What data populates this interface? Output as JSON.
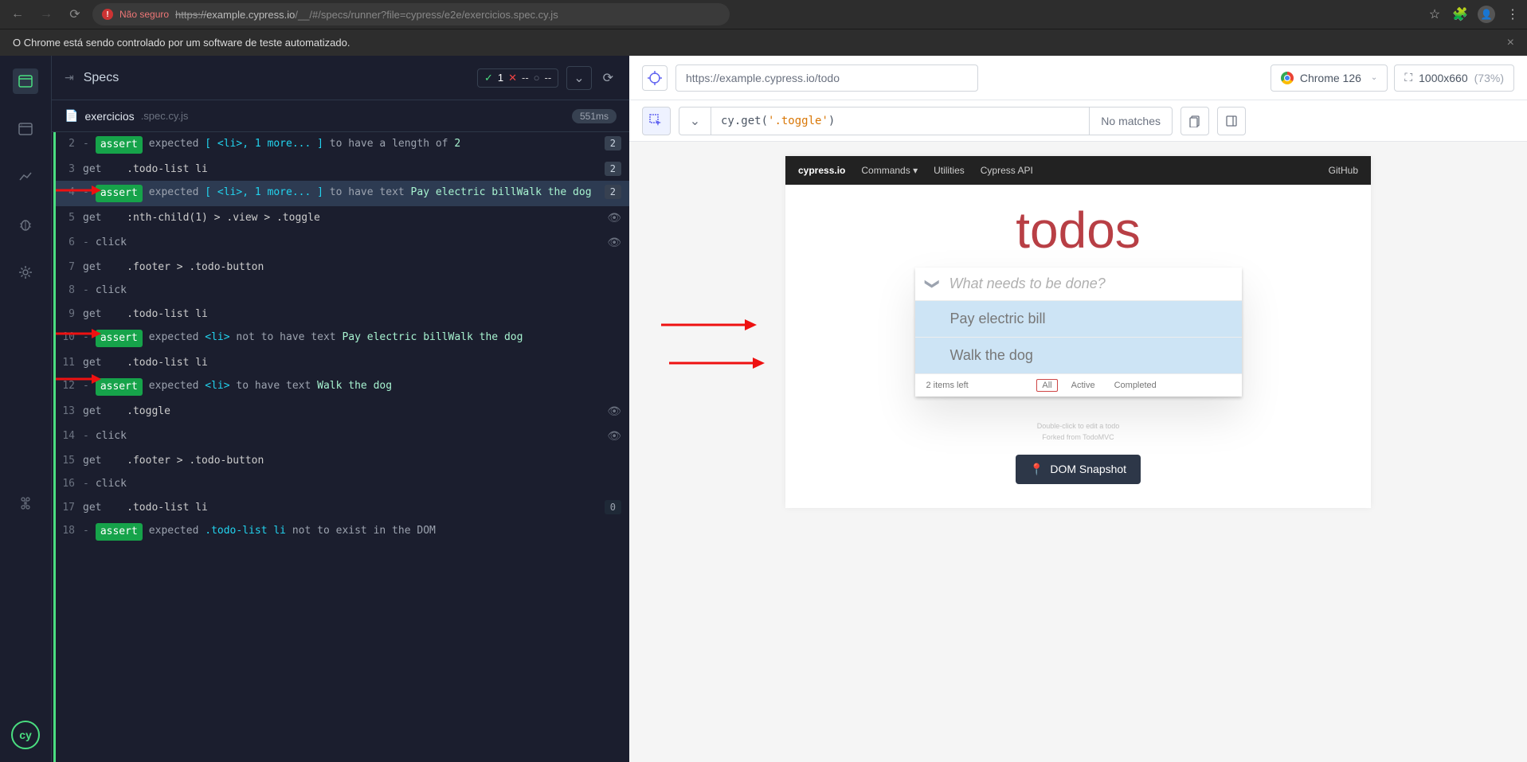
{
  "browser": {
    "insecure_label": "Não seguro",
    "url_prefix": "https://",
    "url_host": "example.cypress.io",
    "url_path": "/__/#/specs/runner?file=cypress/e2e/exercicios.spec.cy.js"
  },
  "automation_banner": "O Chrome está sendo controlado por um software de teste automatizado.",
  "specs_header": {
    "title": "Specs",
    "passed": "1",
    "failed": "--",
    "pending": "--"
  },
  "spec_file": {
    "name": "exercicios",
    "ext": ".spec.cy.js",
    "duration": "551ms"
  },
  "commands": [
    {
      "n": "2",
      "type": "assert",
      "text": "expected [ <li>, 1 more... ] to have a length of 2",
      "badge": "2"
    },
    {
      "n": "3",
      "type": "get",
      "sel": ".todo-list li",
      "badge": "2"
    },
    {
      "n": "4",
      "type": "assert",
      "text": "expected [ <li>, 1 more... ] to have text Pay electric billWalk the dog",
      "badge": "2",
      "hl": true
    },
    {
      "n": "5",
      "type": "get",
      "sel": ":nth-child(1) > .view > .toggle",
      "eye": true
    },
    {
      "n": "6",
      "type": "click",
      "eye": true
    },
    {
      "n": "7",
      "type": "get",
      "sel": ".footer > .todo-button"
    },
    {
      "n": "8",
      "type": "click"
    },
    {
      "n": "9",
      "type": "get",
      "sel": ".todo-list li"
    },
    {
      "n": "10",
      "type": "assert",
      "text": "expected <li> not to have text Pay electric billWalk the dog"
    },
    {
      "n": "11",
      "type": "get",
      "sel": ".todo-list li"
    },
    {
      "n": "12",
      "type": "assert",
      "text": "expected <li> to have text Walk the dog"
    },
    {
      "n": "13",
      "type": "get",
      "sel": ".toggle",
      "eye": true
    },
    {
      "n": "14",
      "type": "click",
      "eye": true
    },
    {
      "n": "15",
      "type": "get",
      "sel": ".footer > .todo-button"
    },
    {
      "n": "16",
      "type": "click"
    },
    {
      "n": "17",
      "type": "get",
      "sel": ".todo-list li",
      "badge": "0",
      "badgeDark": true
    },
    {
      "n": "18",
      "type": "assert",
      "text": "expected .todo-list li not to exist in the DOM"
    }
  ],
  "aut": {
    "url": "https://example.cypress.io/todo",
    "browser_label": "Chrome 126",
    "viewport": "1000x660",
    "viewport_pct": "(73%)"
  },
  "playground": {
    "code_prefix": "cy",
    "code_method": ".get",
    "code_paren_l": "(",
    "code_str": "'.toggle'",
    "code_paren_r": ")",
    "matches": "No matches"
  },
  "todomvc": {
    "brand": "cypress.io",
    "nav": {
      "commands": "Commands",
      "utilities": "Utilities",
      "api": "Cypress API",
      "github": "GitHub"
    },
    "title": "todos",
    "placeholder": "What needs to be done?",
    "items": [
      "Pay electric bill",
      "Walk the dog"
    ],
    "count_text": "2 items left",
    "filters": {
      "all": "All",
      "active": "Active",
      "completed": "Completed"
    },
    "hint1": "Double-click to edit a todo",
    "hint2": "Forked from TodoMVC",
    "snapshot_btn": "DOM Snapshot"
  }
}
